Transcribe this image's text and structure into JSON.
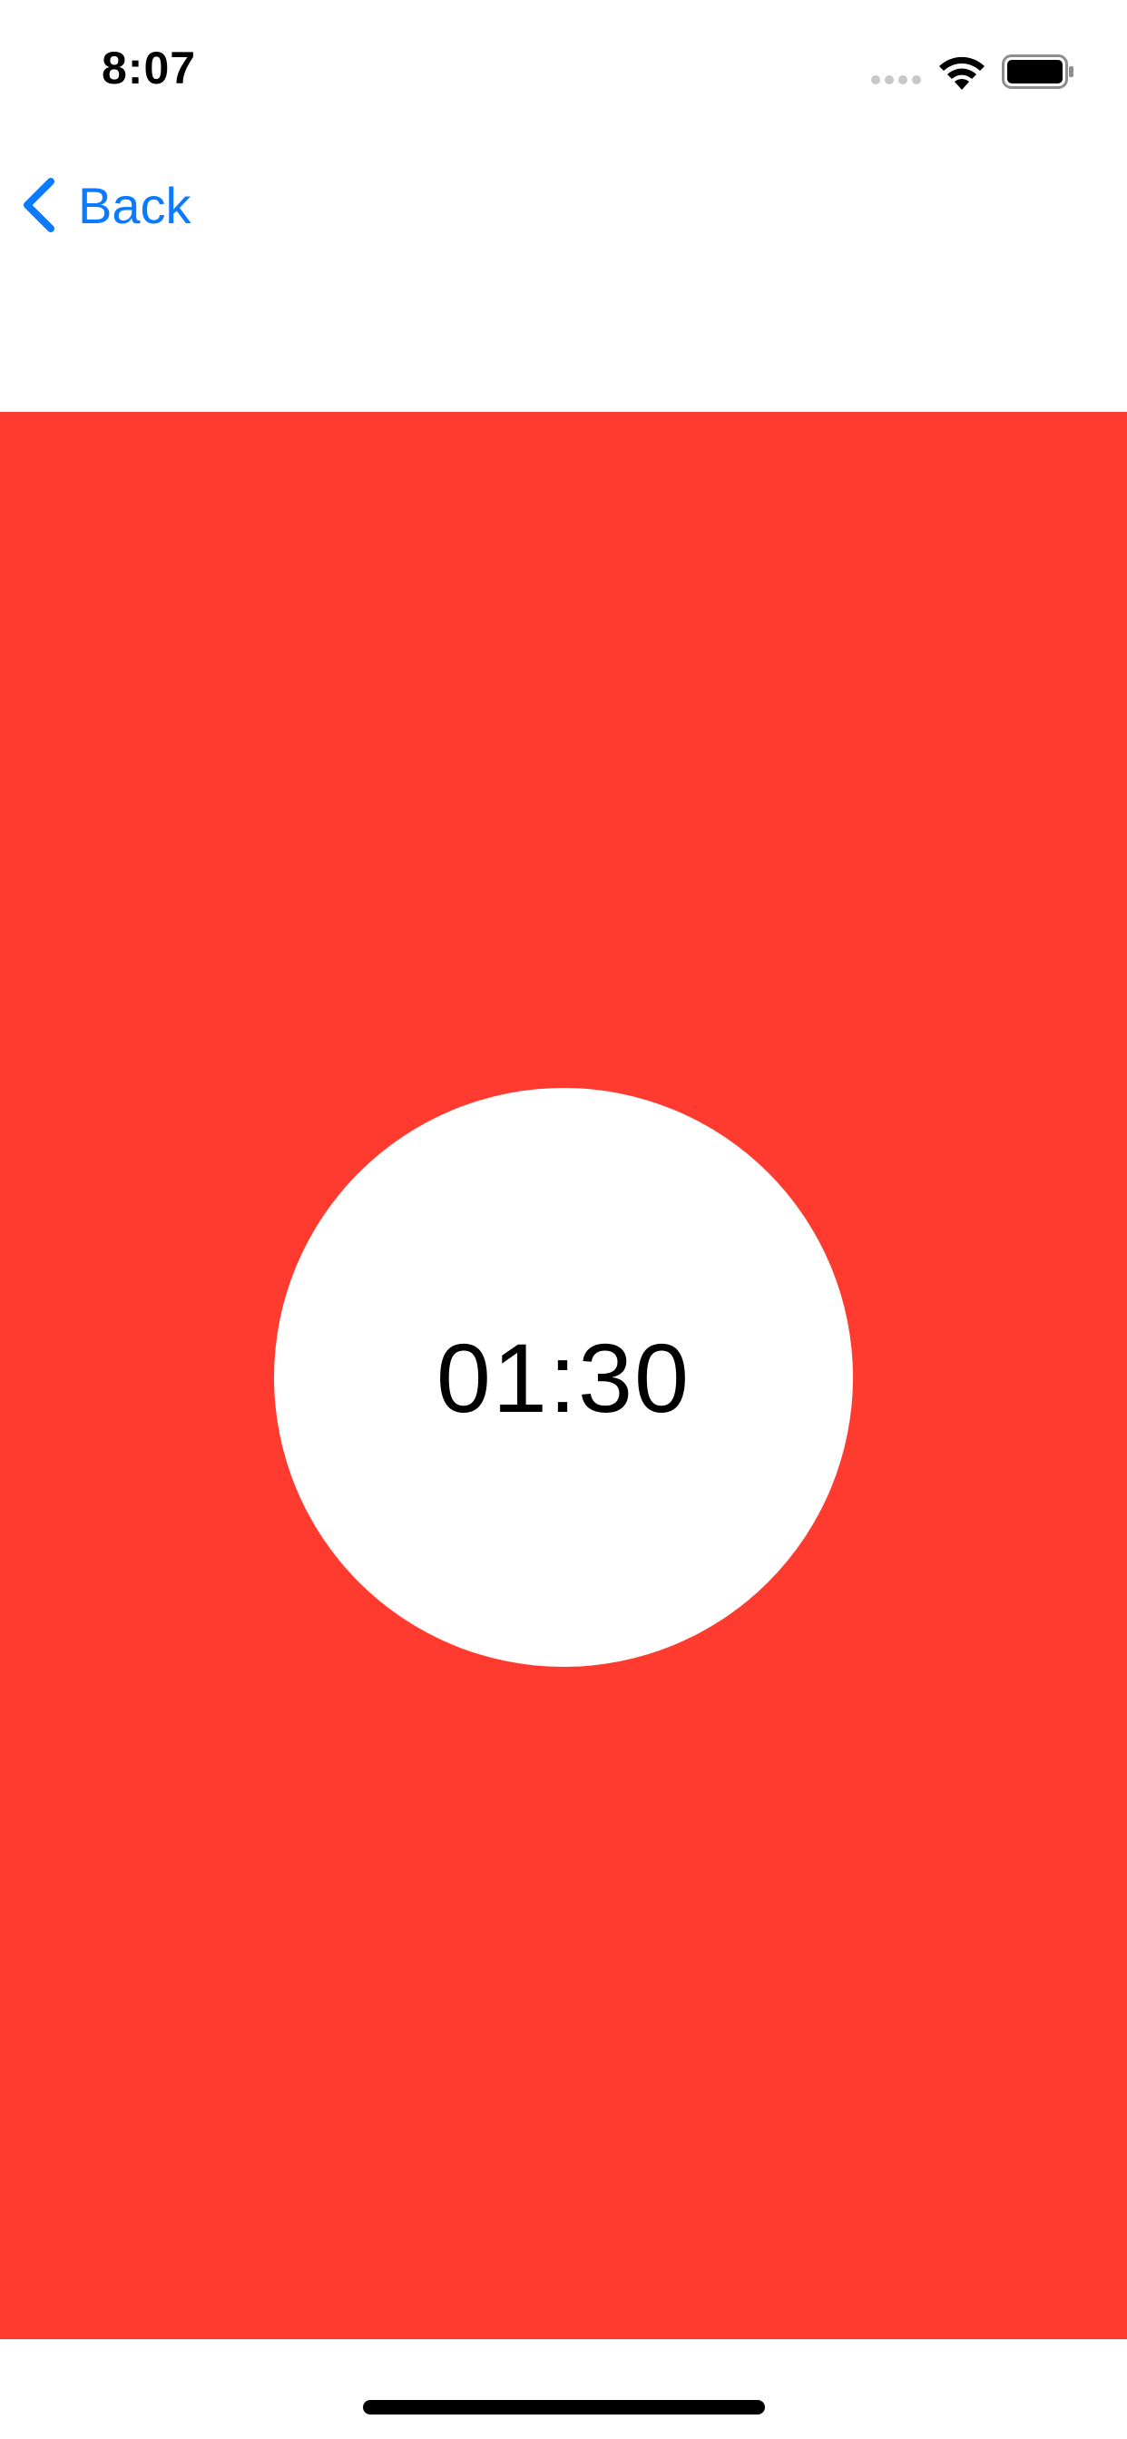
{
  "status_bar": {
    "time": "8:07",
    "signal_icon": "cellular-signal-icon",
    "wifi_icon": "wifi-icon",
    "battery_icon": "battery-icon"
  },
  "nav": {
    "back_label": "Back",
    "back_icon": "chevron-left-icon",
    "accent_color": "#0a7aff"
  },
  "timer": {
    "value": "01:30",
    "background_color": "#ff3b30",
    "circle_color": "#ffffff"
  }
}
